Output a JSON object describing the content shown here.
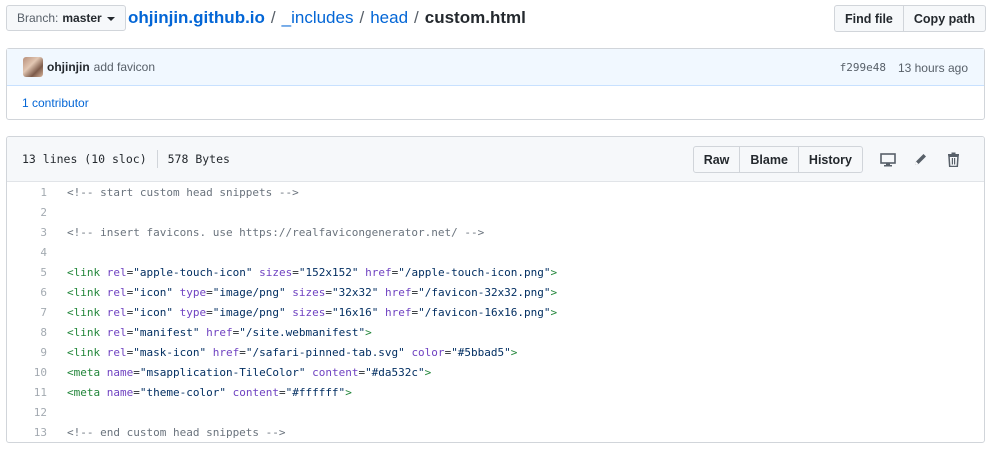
{
  "branch": {
    "prefix": "Branch:",
    "name": "master"
  },
  "breadcrumb": {
    "repo": "ohjinjin.github.io",
    "parts": [
      "_includes",
      "head"
    ],
    "file": "custom.html",
    "separator": "/"
  },
  "top_actions": {
    "find_file": "Find file",
    "copy_path": "Copy path"
  },
  "commit": {
    "author": "ohjinjin",
    "message": "add favicon",
    "sha": "f299e48",
    "time": "13 hours ago",
    "contributors": "1 contributor"
  },
  "file": {
    "lines": "13 lines (10 sloc)",
    "size": "578 Bytes",
    "actions": {
      "raw": "Raw",
      "blame": "Blame",
      "history": "History"
    },
    "icons": [
      "desktop-icon",
      "pencil-icon",
      "trash-icon"
    ]
  },
  "colors": {
    "link": "#0366d6",
    "tag": "#22863a",
    "attr": "#6f42c1",
    "string": "#032f62",
    "comment": "#6a737d"
  },
  "code_lines": [
    {
      "n": "1",
      "tokens": [
        [
          "c",
          "<!-- start custom head snippets -->"
        ]
      ]
    },
    {
      "n": "2",
      "tokens": []
    },
    {
      "n": "3",
      "tokens": [
        [
          "c",
          "<!-- insert favicons. use https://realfavicongenerator.net/ -->"
        ]
      ]
    },
    {
      "n": "4",
      "tokens": []
    },
    {
      "n": "5",
      "tokens": [
        [
          "t",
          "<link "
        ],
        [
          "a",
          "rel"
        ],
        [
          "p",
          "="
        ],
        [
          "s",
          "\"apple-touch-icon\""
        ],
        [
          "p",
          " "
        ],
        [
          "a",
          "sizes"
        ],
        [
          "p",
          "="
        ],
        [
          "s",
          "\"152x152\""
        ],
        [
          "p",
          " "
        ],
        [
          "a",
          "href"
        ],
        [
          "p",
          "="
        ],
        [
          "s",
          "\"/apple-touch-icon.png\""
        ],
        [
          "t",
          ">"
        ]
      ]
    },
    {
      "n": "6",
      "tokens": [
        [
          "t",
          "<link "
        ],
        [
          "a",
          "rel"
        ],
        [
          "p",
          "="
        ],
        [
          "s",
          "\"icon\""
        ],
        [
          "p",
          " "
        ],
        [
          "a",
          "type"
        ],
        [
          "p",
          "="
        ],
        [
          "s",
          "\"image/png\""
        ],
        [
          "p",
          " "
        ],
        [
          "a",
          "sizes"
        ],
        [
          "p",
          "="
        ],
        [
          "s",
          "\"32x32\""
        ],
        [
          "p",
          " "
        ],
        [
          "a",
          "href"
        ],
        [
          "p",
          "="
        ],
        [
          "s",
          "\"/favicon-32x32.png\""
        ],
        [
          "t",
          ">"
        ]
      ]
    },
    {
      "n": "7",
      "tokens": [
        [
          "t",
          "<link "
        ],
        [
          "a",
          "rel"
        ],
        [
          "p",
          "="
        ],
        [
          "s",
          "\"icon\""
        ],
        [
          "p",
          " "
        ],
        [
          "a",
          "type"
        ],
        [
          "p",
          "="
        ],
        [
          "s",
          "\"image/png\""
        ],
        [
          "p",
          " "
        ],
        [
          "a",
          "sizes"
        ],
        [
          "p",
          "="
        ],
        [
          "s",
          "\"16x16\""
        ],
        [
          "p",
          " "
        ],
        [
          "a",
          "href"
        ],
        [
          "p",
          "="
        ],
        [
          "s",
          "\"/favicon-16x16.png\""
        ],
        [
          "t",
          ">"
        ]
      ]
    },
    {
      "n": "8",
      "tokens": [
        [
          "t",
          "<link "
        ],
        [
          "a",
          "rel"
        ],
        [
          "p",
          "="
        ],
        [
          "s",
          "\"manifest\""
        ],
        [
          "p",
          " "
        ],
        [
          "a",
          "href"
        ],
        [
          "p",
          "="
        ],
        [
          "s",
          "\"/site.webmanifest\""
        ],
        [
          "t",
          ">"
        ]
      ]
    },
    {
      "n": "9",
      "tokens": [
        [
          "t",
          "<link "
        ],
        [
          "a",
          "rel"
        ],
        [
          "p",
          "="
        ],
        [
          "s",
          "\"mask-icon\""
        ],
        [
          "p",
          " "
        ],
        [
          "a",
          "href"
        ],
        [
          "p",
          "="
        ],
        [
          "s",
          "\"/safari-pinned-tab.svg\""
        ],
        [
          "p",
          " "
        ],
        [
          "a",
          "color"
        ],
        [
          "p",
          "="
        ],
        [
          "s",
          "\"#5bbad5\""
        ],
        [
          "t",
          ">"
        ]
      ]
    },
    {
      "n": "10",
      "tokens": [
        [
          "t",
          "<meta "
        ],
        [
          "a",
          "name"
        ],
        [
          "p",
          "="
        ],
        [
          "s",
          "\"msapplication-TileColor\""
        ],
        [
          "p",
          " "
        ],
        [
          "a",
          "content"
        ],
        [
          "p",
          "="
        ],
        [
          "s",
          "\"#da532c\""
        ],
        [
          "t",
          ">"
        ]
      ]
    },
    {
      "n": "11",
      "tokens": [
        [
          "t",
          "<meta "
        ],
        [
          "a",
          "name"
        ],
        [
          "p",
          "="
        ],
        [
          "s",
          "\"theme-color\""
        ],
        [
          "p",
          " "
        ],
        [
          "a",
          "content"
        ],
        [
          "p",
          "="
        ],
        [
          "s",
          "\"#ffffff\""
        ],
        [
          "t",
          ">"
        ]
      ]
    },
    {
      "n": "12",
      "tokens": []
    },
    {
      "n": "13",
      "tokens": [
        [
          "c",
          "<!-- end custom head snippets -->"
        ]
      ]
    }
  ]
}
